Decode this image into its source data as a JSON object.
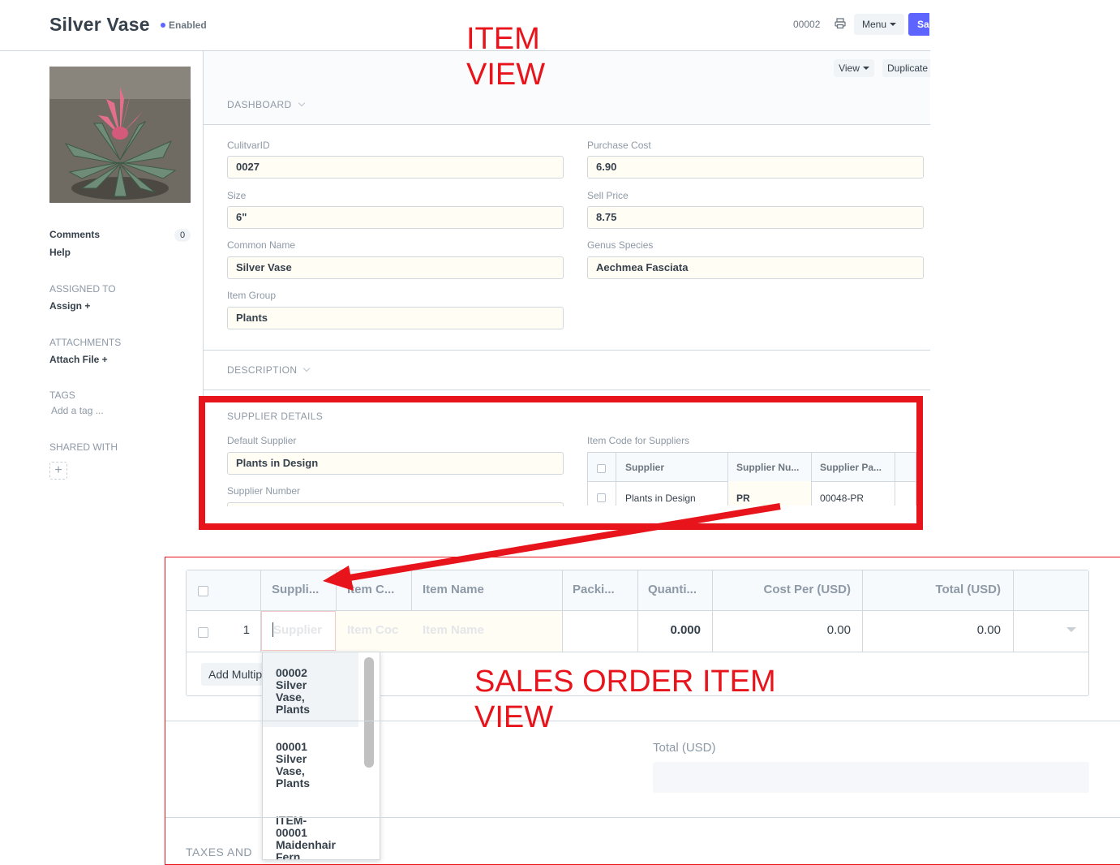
{
  "header": {
    "title": "Silver Vase",
    "status": "Enabled",
    "doc_number": "00002",
    "menu_label": "Menu",
    "save_label": "Save"
  },
  "annotations": {
    "item_view_line1": "ITEM",
    "item_view_line2": "VIEW",
    "so_view_line1": "SALES ORDER ITEM",
    "so_view_line2": "VIEW"
  },
  "sidebar": {
    "comments_label": "Comments",
    "comments_count": "0",
    "help_label": "Help",
    "assigned_heading": "ASSIGNED TO",
    "assign_label": "Assign +",
    "attachments_heading": "ATTACHMENTS",
    "attach_label": "Attach File +",
    "tags_heading": "TAGS",
    "add_tag": "Add a tag ...",
    "shared_heading": "SHARED WITH",
    "share_plus": "+"
  },
  "toolbar": {
    "view_label": "View",
    "duplicate_label": "Duplicate"
  },
  "sections": {
    "dashboard": "DASHBOARD",
    "description": "DESCRIPTION",
    "supplier_details": "SUPPLIER DETAILS"
  },
  "fields": {
    "cultivar_label": "CulitvarID",
    "cultivar_value": "0027",
    "purchase_cost_label": "Purchase Cost",
    "purchase_cost_value": "6.90",
    "size_label": "Size",
    "size_value": "6\"",
    "sell_price_label": "Sell Price",
    "sell_price_value": "8.75",
    "common_name_label": "Common Name",
    "common_name_value": "Silver Vase",
    "genus_label": "Genus Species",
    "genus_value": "Aechmea Fasciata",
    "item_group_label": "Item Group",
    "item_group_value": "Plants",
    "default_supplier_label": "Default Supplier",
    "default_supplier_value": "Plants in Design",
    "supplier_number_label": "Supplier Number",
    "item_code_suppliers_label": "Item Code for Suppliers"
  },
  "supplier_table": {
    "headers": [
      "Supplier",
      "Supplier Nu...",
      "Supplier Pa..."
    ],
    "rows": [
      {
        "supplier": "Plants in Design",
        "supplier_number": "PR",
        "supplier_part": "00048-PR"
      }
    ]
  },
  "sales_order": {
    "headers": [
      "Suppli...",
      "Item C...",
      "Item Name",
      "Packi...",
      "Quanti...",
      "Cost Per (USD)",
      "Total (USD)"
    ],
    "row": {
      "index": "1",
      "supplier_placeholder": "Supplier",
      "item_code_placeholder": "Item Coc",
      "item_name_placeholder": "Item Name",
      "quantity": "0.000",
      "cost_per": "0.00",
      "total": "0.00"
    },
    "add_multiple": "Add Multiple",
    "dropdown": [
      {
        "line1": "00002",
        "line2": "Silver",
        "line3": "Vase,",
        "line4": "Plants"
      },
      {
        "line1": "00001",
        "line2": "Silver",
        "line3": "Vase,",
        "line4": "Plants"
      },
      {
        "line1": "ITEM-",
        "line2": "00001",
        "line3": "Maidenhair",
        "line4": "Fern"
      }
    ],
    "total_label": "Total (USD)",
    "taxes_heading": "TAXES AND"
  },
  "colors": {
    "annotation_red": "#e8141b",
    "primary_blue": "#5e64ff",
    "field_bg": "#fffdf4"
  },
  "icons": [
    "printer-icon",
    "caret-down-icon",
    "chevron-down-icon",
    "plus-icon",
    "arrow-icon"
  ]
}
